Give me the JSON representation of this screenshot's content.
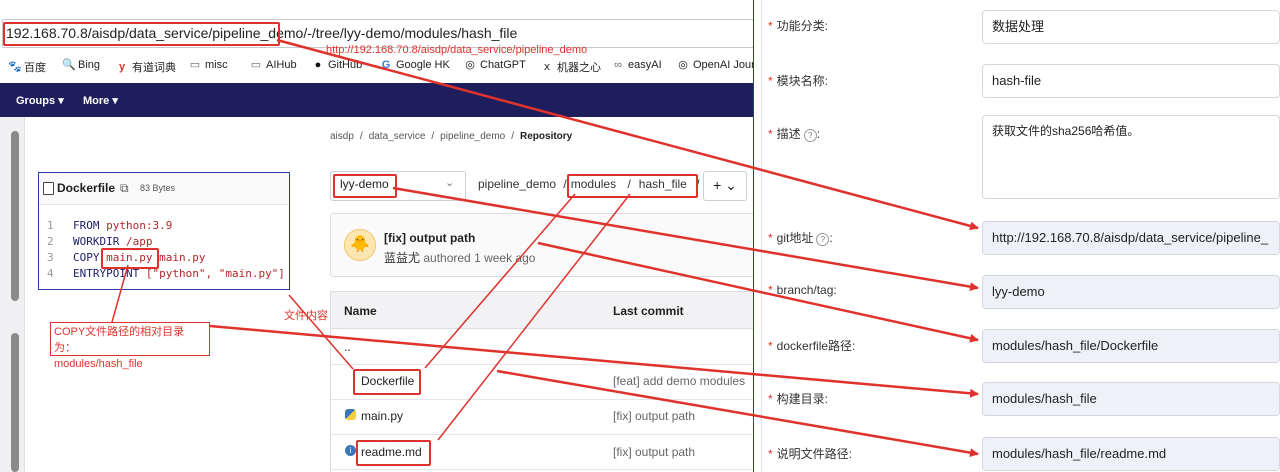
{
  "browser": {
    "url": "192.168.70.8/aisdp/data_service/pipeline_demo/-/tree/lyy-demo/modules/hash_file",
    "url_prefix": "192.168.70.8/aisdp/data_service/pipeline_demo/",
    "url_suffix": "-/tree/lyy-demo/modules/hash_file",
    "url_note": "http://192.168.70.8/aisdp/data_service/pipeline_demo",
    "bookmarks": [
      {
        "icon": "baidu-icon",
        "glyph": "🐾",
        "label": "百度"
      },
      {
        "icon": "bing-search-icon",
        "glyph": "🔍",
        "label": "Bing"
      },
      {
        "icon": "youdao-icon",
        "glyph": "y",
        "label": "有道词典"
      },
      {
        "icon": "folder-icon",
        "glyph": "▭",
        "label": "misc"
      },
      {
        "icon": "folder-icon",
        "glyph": "▭",
        "label": "AIHub"
      },
      {
        "icon": "github-icon",
        "glyph": "●",
        "label": "GitHub"
      },
      {
        "icon": "google-icon",
        "glyph": "G",
        "label": "Google HK"
      },
      {
        "icon": "chatgpt-icon",
        "glyph": "◎",
        "label": "ChatGPT"
      },
      {
        "icon": "jiqizhixin-icon",
        "glyph": "ⅹ",
        "label": "机器之心"
      },
      {
        "icon": "easyai-icon",
        "glyph": "∞",
        "label": "easyAI"
      },
      {
        "icon": "openai-icon",
        "glyph": "◎",
        "label": "OpenAI Jour"
      }
    ],
    "nav": {
      "groups": "Groups",
      "more": "More"
    }
  },
  "repo": {
    "breadcrumb": [
      "aisdp",
      "/",
      "data_service",
      "/",
      "pipeline_demo",
      "/",
      "Repository"
    ],
    "branch": "lyy-demo",
    "path": {
      "root": "pipeline_demo",
      "sep1": "/",
      "dir1": "modules",
      "sep2": "/",
      "dir2": "hash_file",
      "sep3": "/"
    },
    "add_label": "+ ⌄",
    "commit": {
      "message": "[fix] output path",
      "author": "蓝益尤",
      "when": "authored 1 week ago"
    },
    "table": {
      "name_header": "Name",
      "commit_header": "Last commit",
      "rows": [
        {
          "name": "..",
          "icon": "",
          "commit": ""
        },
        {
          "name": "Dockerfile",
          "icon": "",
          "commit": "[feat] add demo modules"
        },
        {
          "name": "main.py",
          "icon": "python-icon",
          "commit": "[fix] output path"
        },
        {
          "name": "readme.md",
          "icon": "info-icon",
          "commit": "[fix] output path"
        }
      ]
    }
  },
  "dockerfile": {
    "title": "Dockerfile",
    "size": "83 Bytes",
    "lines": [
      {
        "no": "1",
        "kw": "FROM",
        "rest": " python:3.9"
      },
      {
        "no": "2",
        "kw": "WORKDIR",
        "rest": " /app"
      },
      {
        "no": "3",
        "kw": "COPY",
        "mid": "main.py",
        "rest": " main.py"
      },
      {
        "no": "4",
        "kw": "ENTRYPOINT",
        "rest": " [\"python\", \"main.py\"]"
      }
    ]
  },
  "annotations": {
    "copy_note_line1": "COPY文件路径的相对目录为：",
    "copy_note_line2": "modules/hash_file",
    "content_note": "文件内容"
  },
  "form": {
    "fields": [
      {
        "label": "功能分类:",
        "value": "数据处理",
        "required": true,
        "help": false
      },
      {
        "label": "模块名称:",
        "value": "hash-file",
        "required": true,
        "help": false
      },
      {
        "label": "描述",
        "value": "获取文件的sha256哈希值。",
        "required": true,
        "help": true
      },
      {
        "label": "git地址",
        "value": "http://192.168.70.8/aisdp/data_service/pipeline_",
        "required": true,
        "help": true
      },
      {
        "label": "branch/tag:",
        "value": "lyy-demo",
        "required": true,
        "help": false
      },
      {
        "label": "dockerfile路径:",
        "value": "modules/hash_file/Dockerfile",
        "required": true,
        "help": false
      },
      {
        "label": "构建目录:",
        "value": "modules/hash_file",
        "required": true,
        "help": false
      },
      {
        "label": "说明文件路径:",
        "value": "modules/hash_file/readme.md",
        "required": true,
        "help": false
      }
    ]
  },
  "colors": {
    "annotation_red": "#e0322c",
    "nav_bg": "#1f1e5c",
    "filled_input": "#eef1f8"
  }
}
